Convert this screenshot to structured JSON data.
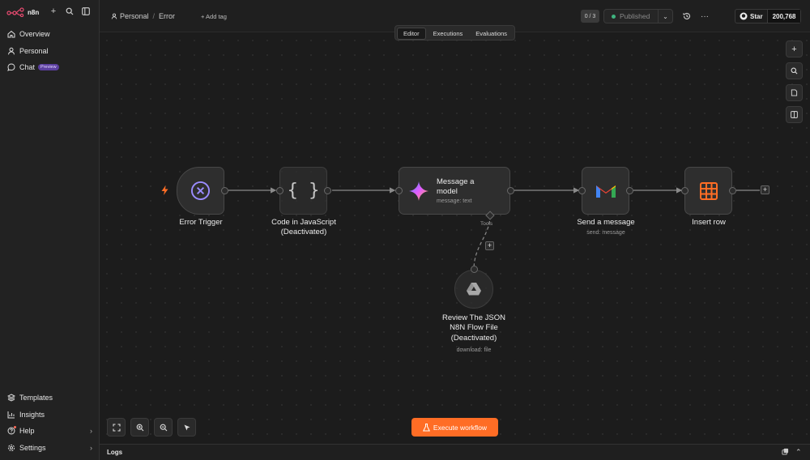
{
  "app": {
    "logo_text": "n8n"
  },
  "sidebar": {
    "top_items": [
      {
        "label": "Overview",
        "icon": "home-icon"
      },
      {
        "label": "Personal",
        "icon": "user-icon"
      },
      {
        "label": "Chat",
        "icon": "chat-icon",
        "badge": "Preview"
      }
    ],
    "bottom_items": [
      {
        "label": "Templates",
        "icon": "templates-icon"
      },
      {
        "label": "Insights",
        "icon": "insights-icon"
      },
      {
        "label": "Help",
        "icon": "help-icon"
      },
      {
        "label": "Settings",
        "icon": "settings-icon"
      }
    ]
  },
  "header": {
    "breadcrumb_project": "Personal",
    "workflow_name": "Error",
    "add_tag": "+ Add tag",
    "counter": "0 / 3",
    "publish_status": "Published",
    "github_label": "Star",
    "github_count": "200,768"
  },
  "tabs": [
    "Editor",
    "Executions",
    "Evaluations"
  ],
  "nodes": {
    "error_trigger": {
      "label": "Error Trigger"
    },
    "code_js": {
      "label": "Code in JavaScript",
      "status": "(Deactivated)"
    },
    "message_model": {
      "label": "Message a model",
      "sub": "message: text",
      "tools_label": "Tools"
    },
    "send_message": {
      "label": "Send a message",
      "sub": "send: message"
    },
    "insert_row": {
      "label": "Insert row"
    },
    "review_json": {
      "label": "Review The JSON N8N Flow File",
      "status": "(Deactivated)",
      "sub": "download: file"
    }
  },
  "execute_button": "Execute workflow",
  "logs_label": "Logs",
  "colors": {
    "accent": "#ff6d25",
    "published_dot": "#3fb37f",
    "trigger_bolt": "#ff6d25"
  }
}
